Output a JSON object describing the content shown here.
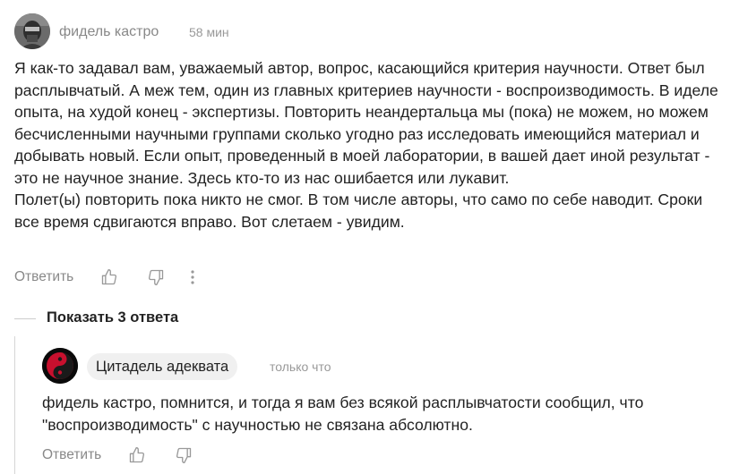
{
  "comment": {
    "author": "фидель кастро",
    "time": "58 мин",
    "paragraphs": [
      "Я как-то задавал вам, уважаемый автор, вопрос, касающийся критерия научности. Ответ был расплывчатый. А меж тем, один из главных критериев научности - воспроизводимость. В иделе опыта, на худой конец - экспертизы. Повторить неандертальца мы (пока) не можем, но можем бесчисленными научными группами сколько угодно раз исследовать имеющийся материал и добывать новый. Если опыт, проведенный в моей лаборатории, в вашей дает иной результат - это не научное знание. Здесь кто-то из нас ошибается или лукавит.",
      "Полет(ы) повторить пока никто не смог. В том числе авторы, что само по себе наводит. Сроки все время сдвигаются вправо. Вот слетаем - увидим."
    ],
    "actions": {
      "reply_label": "Ответить"
    }
  },
  "replies_toggle": {
    "label": "Показать 3 ответа"
  },
  "reply": {
    "author": "Цитадель адеквата",
    "time": "только что",
    "text": "фидель кастро, помнится, и тогда я вам без всякой расплывчатости сообщил, что \"воспроизводимость\" с научностью не связана абсолютно.",
    "actions": {
      "reply_label": "Ответить"
    }
  },
  "icons": [
    "thumbs-up-icon",
    "thumbs-down-icon",
    "more-vertical-icon",
    "yin-yang-icon"
  ],
  "colors": {
    "text": "#222222",
    "muted": "#888888",
    "chip_bg": "#f0f0f0",
    "reply_avatar_accent": "#c8102e"
  }
}
